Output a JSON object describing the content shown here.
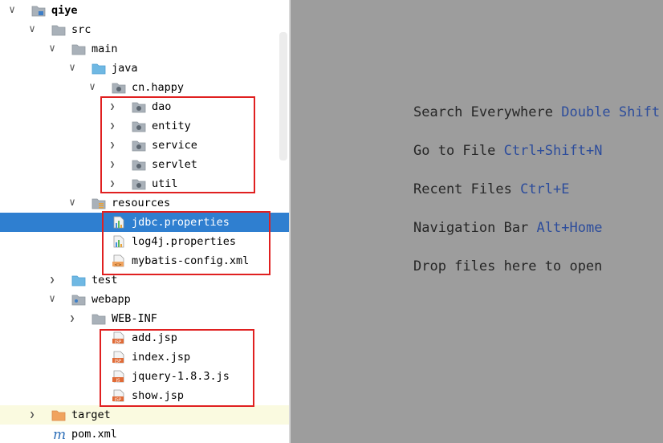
{
  "tree": {
    "rows": [
      {
        "label": "qiye",
        "arrow": "down",
        "icon": "folder-module-icon"
      },
      {
        "label": "src",
        "arrow": "down",
        "icon": "folder-icon"
      },
      {
        "label": "main",
        "arrow": "down",
        "icon": "folder-icon"
      },
      {
        "label": "java",
        "arrow": "down",
        "icon": "source-folder-icon"
      },
      {
        "label": "cn.happy",
        "arrow": "down",
        "icon": "package-icon"
      },
      {
        "label": "dao",
        "arrow": "right",
        "icon": "package-icon"
      },
      {
        "label": "entity",
        "arrow": "right",
        "icon": "package-icon"
      },
      {
        "label": "service",
        "arrow": "right",
        "icon": "package-icon"
      },
      {
        "label": "servlet",
        "arrow": "right",
        "icon": "package-icon"
      },
      {
        "label": "util",
        "arrow": "right",
        "icon": "package-icon"
      },
      {
        "label": "resources",
        "arrow": "down",
        "icon": "resources-folder-icon"
      },
      {
        "label": "jdbc.properties",
        "arrow": "",
        "icon": "properties-file-icon"
      },
      {
        "label": "log4j.properties",
        "arrow": "",
        "icon": "properties-file-icon"
      },
      {
        "label": "mybatis-config.xml",
        "arrow": "",
        "icon": "xml-file-icon"
      },
      {
        "label": "test",
        "arrow": "right",
        "icon": "test-folder-icon"
      },
      {
        "label": "webapp",
        "arrow": "down",
        "icon": "web-folder-icon"
      },
      {
        "label": "WEB-INF",
        "arrow": "right",
        "icon": "folder-icon"
      },
      {
        "label": "add.jsp",
        "arrow": "",
        "icon": "jsp-file-icon"
      },
      {
        "label": "index.jsp",
        "arrow": "",
        "icon": "jsp-file-icon"
      },
      {
        "label": "jquery-1.8.3.js",
        "arrow": "",
        "icon": "js-file-icon"
      },
      {
        "label": "show.jsp",
        "arrow": "",
        "icon": "jsp-file-icon"
      },
      {
        "label": "target",
        "arrow": "right",
        "icon": "excluded-folder-icon"
      },
      {
        "label": "pom.xml",
        "arrow": "",
        "icon": "maven-icon"
      }
    ],
    "icon_texts": {
      "jsp": "JSP",
      "js": "JS",
      "xml": "<>",
      "maven": "m"
    }
  },
  "editor": {
    "hints": [
      {
        "text": "Search Everywhere",
        "key": "Double Shift"
      },
      {
        "text": "Go to File",
        "key": "Ctrl+Shift+N"
      },
      {
        "text": "Recent Files",
        "key": "Ctrl+E"
      },
      {
        "text": "Navigation Bar",
        "key": "Alt+Home"
      },
      {
        "text": "Drop files here to open",
        "key": ""
      }
    ]
  },
  "colors": {
    "selection": "#2f7fd0",
    "editor_bg": "#9d9d9d",
    "key_text": "#2d4d9c",
    "highlight_box": "#e02020"
  }
}
